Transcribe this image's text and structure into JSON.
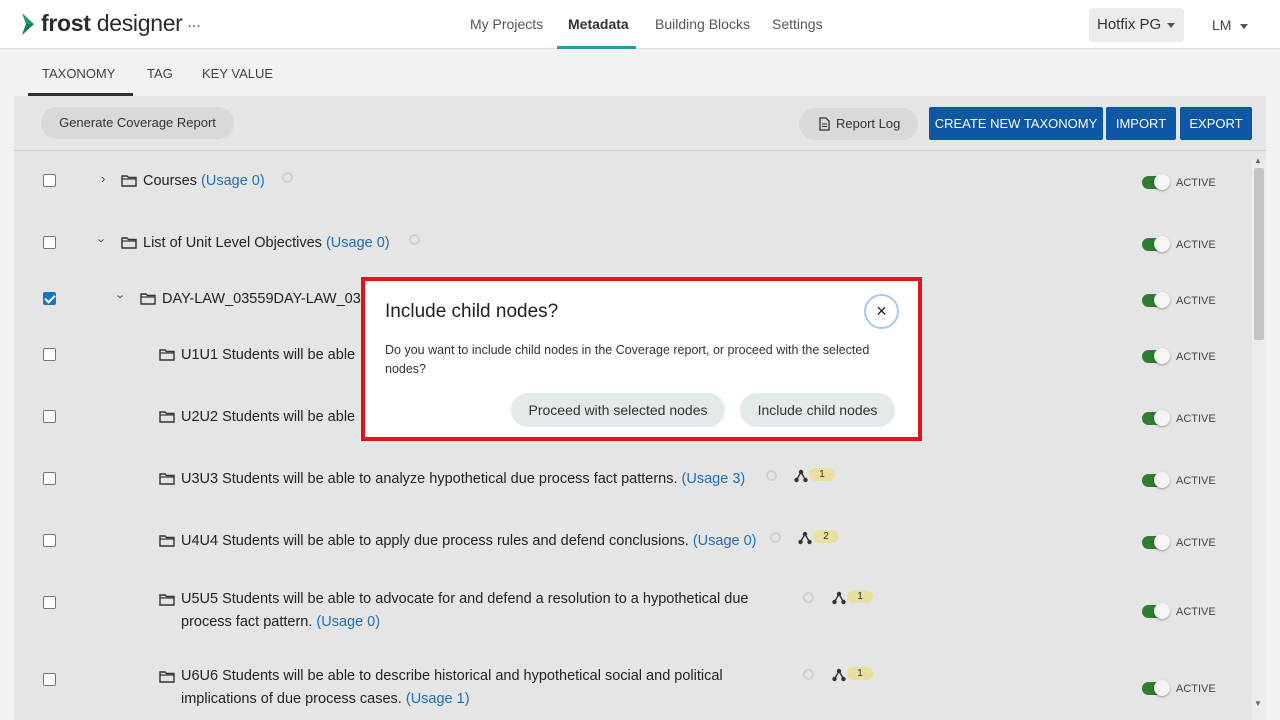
{
  "brand": {
    "logo_bold": "frost",
    "logo_rest": " designer",
    "more_label": "..."
  },
  "nav": [
    {
      "label": "My Projects",
      "active": false
    },
    {
      "label": "Metadata",
      "active": true
    },
    {
      "label": "Building Blocks",
      "active": false
    },
    {
      "label": "Settings",
      "active": false
    }
  ],
  "environment": {
    "label": "Hotfix PG"
  },
  "user": {
    "initials": "LM"
  },
  "subtabs": [
    {
      "label": "TAXONOMY",
      "active": true
    },
    {
      "label": "TAG",
      "active": false
    },
    {
      "label": "KEY VALUE",
      "active": false
    }
  ],
  "toolbar": {
    "coverage_label": "Generate Coverage Report",
    "report_log_label": "Report Log",
    "create_label": "CREATE NEW TAXONOMY",
    "import_label": "IMPORT",
    "export_label": "EXPORT"
  },
  "status_label": "ACTIVE",
  "rows": [
    {
      "text": "Courses",
      "usage": "(Usage 0)",
      "checked": false,
      "expand": "collapsed",
      "badge": null
    },
    {
      "text": "List of Unit Level Objectives",
      "usage": "(Usage 0)",
      "checked": false,
      "expand": "expanded",
      "badge": null
    },
    {
      "text": "DAY-LAW_03559DAY-LAW_03",
      "usage": "",
      "checked": true,
      "expand": "expanded",
      "badge": null
    },
    {
      "text": "U1U1 Students will be able",
      "usage": "",
      "checked": false,
      "expand": "none",
      "badge": null
    },
    {
      "text": "U2U2 Students will be able",
      "usage": "",
      "checked": false,
      "expand": "none",
      "badge": null
    },
    {
      "text": "U3U3 Students will be able to analyze hypothetical due process fact patterns.",
      "usage": "(Usage 3)",
      "checked": false,
      "expand": "none",
      "badge": "1"
    },
    {
      "text": "U4U4 Students will be able to apply due process rules and defend conclusions.",
      "usage": "(Usage 0)",
      "checked": false,
      "expand": "none",
      "badge": "2"
    },
    {
      "text": "U5U5 Students will be able to advocate for and defend a resolution to a hypothetical due",
      "text2": "process fact pattern.",
      "usage": "(Usage 0)",
      "checked": false,
      "expand": "none",
      "badge": "1"
    },
    {
      "text": "U6U6 Students will be able to describe historical and hypothetical social and political",
      "text2": "implications of due process cases.",
      "usage": "(Usage 1)",
      "checked": false,
      "expand": "none",
      "badge": "1"
    }
  ],
  "modal": {
    "title": "Include child nodes?",
    "body": "Do you want to include child nodes in the Coverage report, or proceed with the selected nodes?",
    "proceed_label": "Proceed with selected nodes",
    "include_label": "Include child nodes",
    "close_glyph": "×"
  },
  "colors": {
    "accent": "#2a9aa6",
    "primary_button": "#0d57a5",
    "toggle_on": "#2e7d32",
    "link": "#1f6fb5",
    "highlight_border": "#e0141b",
    "badge": "#e8dfa0"
  },
  "icons": [
    "frost-logo-icon",
    "caret-down-icon",
    "document-icon",
    "chevron-right-icon",
    "chevron-down-icon",
    "folder-icon",
    "gear-icon",
    "hierarchy-icon",
    "close-icon"
  ]
}
